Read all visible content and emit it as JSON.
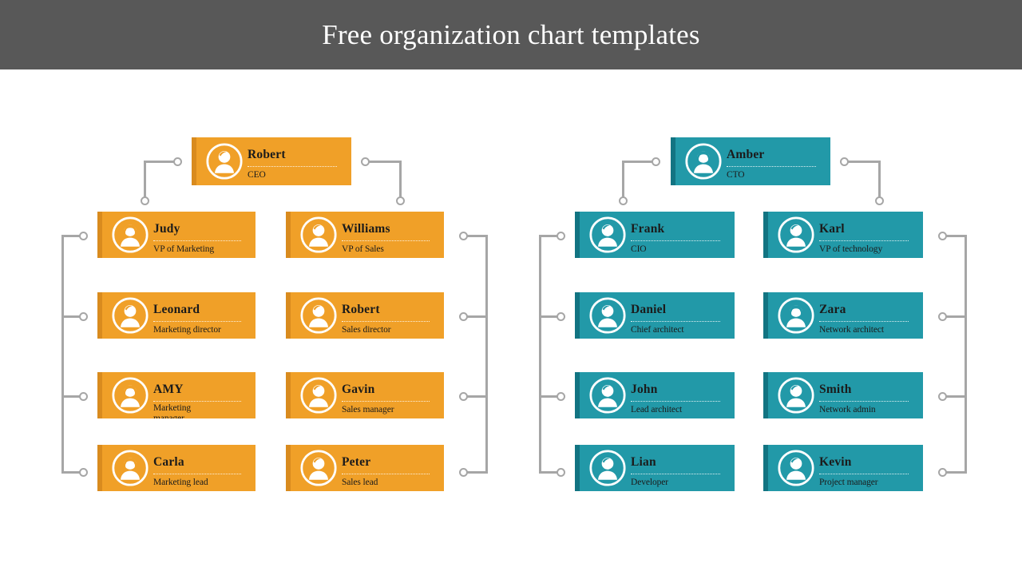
{
  "header": {
    "title": "Free organization chart templates",
    "background_color": "#585858",
    "text_color": "#ffffff"
  },
  "theme": {
    "page_background": "#ffffff",
    "orange_fill": "#f0a028",
    "orange_edge": "#d98b1e",
    "teal_fill": "#2299a8",
    "teal_edge": "#127482",
    "connector_color": "#a6a6a6",
    "name_text_color": "#1b1b1b"
  },
  "chart_data": {
    "type": "diagram",
    "subtype": "organization-chart",
    "title": "Free organization chart templates",
    "branches": [
      {
        "id": "branch-ceo",
        "color": "#f0a028",
        "edge_color": "#d98b1e",
        "root": {
          "id": "node-robert-ceo",
          "name": "Robert",
          "role": "CEO",
          "avatar": "avatar-male-icon"
        },
        "columns": [
          {
            "id": "column-marketing",
            "head": {
              "id": "node-judy",
              "name": "Judy",
              "role": "VP of Marketing",
              "avatar": "avatar-female-icon"
            },
            "reports": [
              {
                "id": "node-leonard",
                "name": "Leonard",
                "role": "Marketing director",
                "avatar": "avatar-male-icon"
              },
              {
                "id": "node-amy",
                "name": "AMY",
                "role": "Marketing manager",
                "avatar": "avatar-female-icon",
                "wraps": true
              },
              {
                "id": "node-carla",
                "name": "Carla",
                "role": "Marketing lead",
                "avatar": "avatar-female-icon"
              }
            ]
          },
          {
            "id": "column-sales",
            "head": {
              "id": "node-williams",
              "name": "Williams",
              "role": "VP of Sales",
              "avatar": "avatar-male-icon"
            },
            "reports": [
              {
                "id": "node-robert-sales",
                "name": "Robert",
                "role": "Sales director",
                "avatar": "avatar-male-icon"
              },
              {
                "id": "node-gavin",
                "name": "Gavin",
                "role": "Sales manager",
                "avatar": "avatar-male-icon"
              },
              {
                "id": "node-peter",
                "name": "Peter",
                "role": "Sales lead",
                "avatar": "avatar-male-icon"
              }
            ]
          }
        ]
      },
      {
        "id": "branch-cto",
        "color": "#2299a8",
        "edge_color": "#127482",
        "root": {
          "id": "node-amber-cto",
          "name": "Amber",
          "role": "CTO",
          "avatar": "avatar-female-icon"
        },
        "columns": [
          {
            "id": "column-information",
            "head": {
              "id": "node-frank",
              "name": "Frank",
              "role": "CIO",
              "avatar": "avatar-male-icon"
            },
            "reports": [
              {
                "id": "node-daniel",
                "name": "Daniel",
                "role": "Chief architect",
                "avatar": "avatar-male-icon"
              },
              {
                "id": "node-john",
                "name": "John",
                "role": "Lead architect",
                "avatar": "avatar-male-icon"
              },
              {
                "id": "node-lian",
                "name": "Lian",
                "role": "Developer",
                "avatar": "avatar-male-icon"
              }
            ]
          },
          {
            "id": "column-technology",
            "head": {
              "id": "node-karl",
              "name": "Karl",
              "role": "VP of technology",
              "avatar": "avatar-male-icon"
            },
            "reports": [
              {
                "id": "node-zara",
                "name": "Zara",
                "role": "Network architect",
                "avatar": "avatar-female-icon"
              },
              {
                "id": "node-smith",
                "name": "Smith",
                "role": "Network admin",
                "avatar": "avatar-male-icon"
              },
              {
                "id": "node-kevin",
                "name": "Kevin",
                "role": "Project manager",
                "avatar": "avatar-male-icon"
              }
            ]
          }
        ]
      }
    ]
  },
  "nodes": {
    "robert_ceo": {
      "name": "Robert",
      "role": "CEO"
    },
    "judy": {
      "name": "Judy",
      "role": "VP of Marketing"
    },
    "leonard": {
      "name": "Leonard",
      "role": "Marketing director"
    },
    "amy": {
      "name": "AMY",
      "role": "Marketing manager"
    },
    "carla": {
      "name": "Carla",
      "role": "Marketing lead"
    },
    "williams": {
      "name": "Williams",
      "role": "VP of Sales"
    },
    "robert_sales": {
      "name": "Robert",
      "role": "Sales director"
    },
    "gavin": {
      "name": "Gavin",
      "role": "Sales manager"
    },
    "peter": {
      "name": "Peter",
      "role": "Sales lead"
    },
    "amber_cto": {
      "name": "Amber",
      "role": "CTO"
    },
    "frank": {
      "name": "Frank",
      "role": "CIO"
    },
    "daniel": {
      "name": "Daniel",
      "role": "Chief architect"
    },
    "john": {
      "name": "John",
      "role": "Lead architect"
    },
    "lian": {
      "name": "Lian",
      "role": "Developer"
    },
    "karl": {
      "name": "Karl",
      "role": "VP of technology"
    },
    "zara": {
      "name": "Zara",
      "role": "Network architect"
    },
    "smith": {
      "name": "Smith",
      "role": "Network admin"
    },
    "kevin": {
      "name": "Kevin",
      "role": "Project manager"
    }
  }
}
